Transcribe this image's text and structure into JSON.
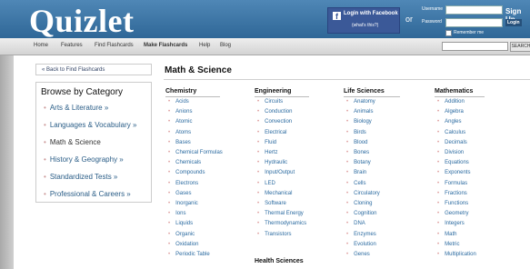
{
  "header": {
    "logo": "Quizlet",
    "fb_login": "Login with Facebook",
    "fb_whats": "(what's this?)",
    "or": "or",
    "username_label": "Username",
    "password_label": "Password",
    "login_button": "Login",
    "remember_me": "Remember me",
    "signup": "Sign Up"
  },
  "nav": {
    "items": [
      "Home",
      "Features",
      "Find Flashcards",
      "Make Flashcards",
      "Help",
      "Blog"
    ],
    "search_button": "SEARCH"
  },
  "sidebar": {
    "back_link": "« Back to Find Flashcards",
    "title": "Browse by Category",
    "categories": [
      "Arts & Literature »",
      "Languages & Vocabulary »",
      "Math & Science",
      "History & Geography »",
      "Standardized Tests »",
      "Professional & Careers »"
    ]
  },
  "main": {
    "title": "Math & Science",
    "columns": [
      {
        "heading": "Chemistry",
        "items": [
          "Acids",
          "Anions",
          "Atomic",
          "Atoms",
          "Bases",
          "Chemical Formulas",
          "Chemicals",
          "Compounds",
          "Electrons",
          "Gases",
          "Inorganic",
          "Ions",
          "Liquids",
          "Organic",
          "Oxidation",
          "Periodic Table"
        ]
      },
      {
        "heading": "Engineering",
        "items": [
          "Circuits",
          "Conduction",
          "Convection",
          "Electrical",
          "Fluid",
          "Hertz",
          "Hydraulic",
          "Input/Output",
          "LED",
          "Mechanical",
          "Software",
          "Thermal Energy",
          "Thermodynamics",
          "Transistors"
        ]
      },
      {
        "heading": "Life Sciences",
        "items": [
          "Anatomy",
          "Animals",
          "Biology",
          "Birds",
          "Blood",
          "Bones",
          "Botany",
          "Brain",
          "Cells",
          "Circulatory",
          "Cloning",
          "Cognition",
          "DNA",
          "Enzymes",
          "Evolution",
          "Genes"
        ]
      },
      {
        "heading": "Mathematics",
        "items": [
          "Addition",
          "Algebra",
          "Angles",
          "Calculus",
          "Decimals",
          "Division",
          "Equations",
          "Exponents",
          "Formulas",
          "Fractions",
          "Functions",
          "Geometry",
          "Integers",
          "Math",
          "Metric",
          "Multiplication"
        ]
      }
    ],
    "extra_heading": "Health Sciences"
  }
}
